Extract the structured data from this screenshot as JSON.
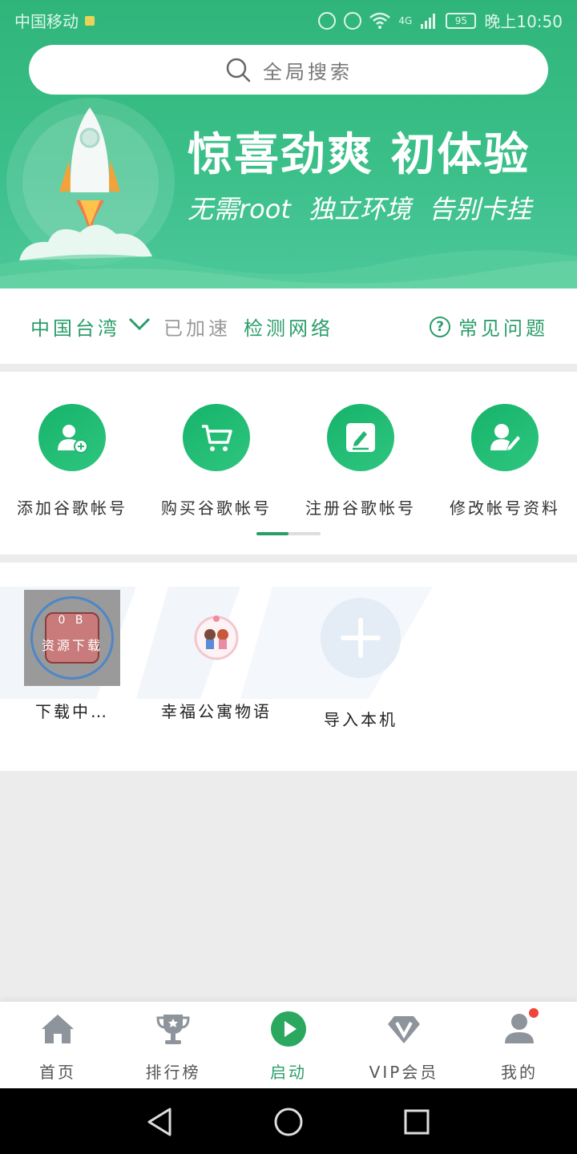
{
  "status_bar": {
    "carrier": "中国移动",
    "time": "晚上10:50",
    "battery": "95",
    "network": "4G"
  },
  "search": {
    "placeholder": "全局搜索"
  },
  "banner": {
    "title": "惊喜劲爽  初体验",
    "subtitle": "无需root  独立环境  告别卡挂"
  },
  "region_bar": {
    "region": "中国台湾",
    "status": "已加速",
    "check_network": "检测网络",
    "faq": "常见问题"
  },
  "actions": [
    {
      "label": "添加谷歌帐号",
      "icon": "add-user-icon"
    },
    {
      "label": "购买谷歌帐号",
      "icon": "cart-icon"
    },
    {
      "label": "注册谷歌帐号",
      "icon": "edit-icon"
    },
    {
      "label": "修改帐号资料",
      "icon": "user-edit-icon"
    }
  ],
  "pager": {
    "active_index": 0,
    "pages": 2
  },
  "apps": [
    {
      "label": "下载中…",
      "download_size": "0 B",
      "download_text": "资源下载",
      "icon": "downloading-app-icon"
    },
    {
      "label": "幸福公寓物语",
      "icon": "app-icon"
    },
    {
      "label": "导入本机",
      "icon": "plus-icon"
    }
  ],
  "bottom_nav": [
    {
      "label": "首页",
      "icon": "home-icon",
      "active": false
    },
    {
      "label": "排行榜",
      "icon": "trophy-icon",
      "active": false
    },
    {
      "label": "启动",
      "icon": "play-icon",
      "active": true
    },
    {
      "label": "VIP会员",
      "icon": "vip-icon",
      "active": false
    },
    {
      "label": "我的",
      "icon": "profile-icon",
      "active": false,
      "badge": true
    }
  ],
  "colors": {
    "brand_green": "#2a9d6a",
    "header_green": "#3cc08a",
    "badge_red": "#f0443a"
  }
}
